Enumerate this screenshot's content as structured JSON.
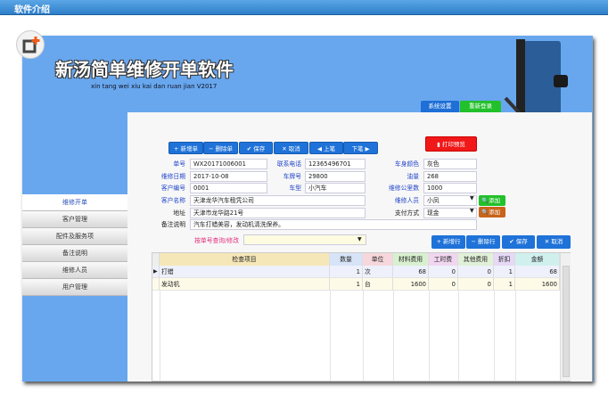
{
  "window_title": "软件介绍",
  "app": {
    "title": "新汤简单维修开单软件",
    "subtitle": "xin tang wei xiu kai dan ruan jian  V2017",
    "top_buttons": {
      "settings": "系统设置",
      "relogin": "重新登录"
    }
  },
  "sidebar": {
    "items": [
      {
        "label": "维修开单"
      },
      {
        "label": "客户管理"
      },
      {
        "label": "配件及服务项"
      },
      {
        "label": "备注说明"
      },
      {
        "label": "维修人员"
      },
      {
        "label": "用户管理"
      }
    ]
  },
  "toolbar": {
    "new": "+ 新增单",
    "delete": "− 删除单",
    "save": "✔ 保存",
    "cancel": "✕ 取消",
    "prev": "◀ 上笔",
    "next": "下笔 ▶",
    "print": "打印预览"
  },
  "form": {
    "order_no": {
      "label": "单号",
      "value": "WX20171006001"
    },
    "phone": {
      "label": "联系电话",
      "value": "12365496701"
    },
    "car_color": {
      "label": "车身颜色",
      "value": "灰色"
    },
    "repair_date": {
      "label": "维修日期",
      "value": "2017-10-08"
    },
    "plate": {
      "label": "车牌号",
      "value": "29800"
    },
    "fuel": {
      "label": "油量",
      "value": "268"
    },
    "customer_no": {
      "label": "客户编号",
      "value": "0001"
    },
    "car_type": {
      "label": "车型",
      "value": "小汽车"
    },
    "mileage": {
      "label": "维修公里数",
      "value": "1000"
    },
    "customer_name": {
      "label": "客户名称",
      "value": "天津龙华汽车租凭公司"
    },
    "repairer": {
      "label": "维修人员",
      "value": "小凤"
    },
    "address": {
      "label": "地址",
      "value": "天津市龙华路21号"
    },
    "payment": {
      "label": "支付方式",
      "value": "现金"
    },
    "remark": {
      "label": "备注说明",
      "value": "汽车打蜡美容，发动机清洗保养。"
    },
    "add_label": "添加"
  },
  "query": {
    "label": "按单号查询/修改",
    "value": ""
  },
  "row_buttons": {
    "add": "+ 新增行",
    "delete": "− 删除行",
    "save": "✔ 保存",
    "cancel": "✕ 取消"
  },
  "grid": {
    "columns": [
      "检查项目",
      "数量",
      "单位",
      "材料费用",
      "工时费",
      "其他费用",
      "折扣",
      "金额"
    ],
    "rows": [
      [
        "打蜡",
        "1",
        "次",
        "68",
        "0",
        "0",
        "1",
        "68"
      ],
      [
        "发动机",
        "1",
        "台",
        "1600",
        "0",
        "0",
        "1",
        "1600"
      ]
    ]
  }
}
